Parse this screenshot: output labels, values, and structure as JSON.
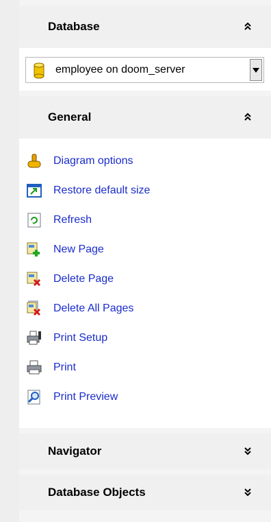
{
  "sections": {
    "database": {
      "title": "Database",
      "connection": "employee on doom_server"
    },
    "general": {
      "title": "General",
      "actions": [
        {
          "label": "Diagram options",
          "icon": "diagram-options-icon"
        },
        {
          "label": "Restore default size",
          "icon": "restore-size-icon"
        },
        {
          "label": "Refresh",
          "icon": "refresh-icon"
        },
        {
          "label": "New Page",
          "icon": "new-page-icon"
        },
        {
          "label": "Delete Page",
          "icon": "delete-page-icon"
        },
        {
          "label": "Delete All Pages",
          "icon": "delete-all-pages-icon"
        },
        {
          "label": "Print Setup",
          "icon": "print-setup-icon"
        },
        {
          "label": "Print",
          "icon": "printer-icon"
        },
        {
          "label": "Print Preview",
          "icon": "print-preview-icon"
        }
      ]
    },
    "navigator": {
      "title": "Navigator"
    },
    "database_objects": {
      "title": "Database Objects"
    }
  }
}
